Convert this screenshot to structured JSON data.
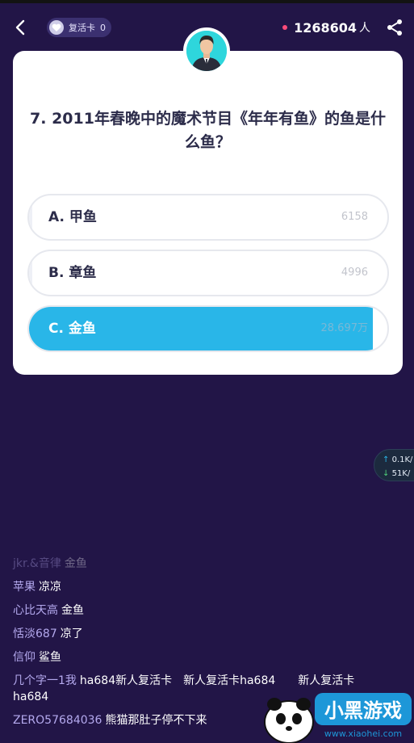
{
  "header": {
    "revive_label": "复活卡",
    "revive_count": "0",
    "viewer_count": "1268604",
    "viewer_unit": "人"
  },
  "question": {
    "text": "7. 2011年春晚中的魔术节目《年年有鱼》的鱼是什么鱼？"
  },
  "options": [
    {
      "label": "A. 甲鱼",
      "count": "6158",
      "fill": 0.01
    },
    {
      "label": "B. 章鱼",
      "count": "4996",
      "fill": 0.01
    },
    {
      "label": "C. 金鱼",
      "count": "28.697万",
      "fill": 0.96
    }
  ],
  "netspeed": {
    "up": "0.1K/",
    "down": "51K/"
  },
  "chat": [
    {
      "user": "jkr.&音律",
      "text": "金鱼"
    },
    {
      "user": "苹果",
      "text": "凉凉"
    },
    {
      "user": "心比天高",
      "text": "金鱼"
    },
    {
      "user": "恬淡687",
      "text": "凉了"
    },
    {
      "user": "信仰",
      "text": "鲨鱼"
    },
    {
      "user": "几个字一1我",
      "text": "ha684新人复活卡　新人复活卡ha684　　新人复活卡ha684"
    },
    {
      "user": "ZERO57684036",
      "text": "熊猫那肚子停不下来"
    }
  ],
  "watermark": {
    "brand": "小黑游戏",
    "url": "www.xiaohei.com"
  },
  "colors": {
    "background": "#221547",
    "accent": "#29b6e8",
    "live_dot": "#ff4b7a"
  }
}
